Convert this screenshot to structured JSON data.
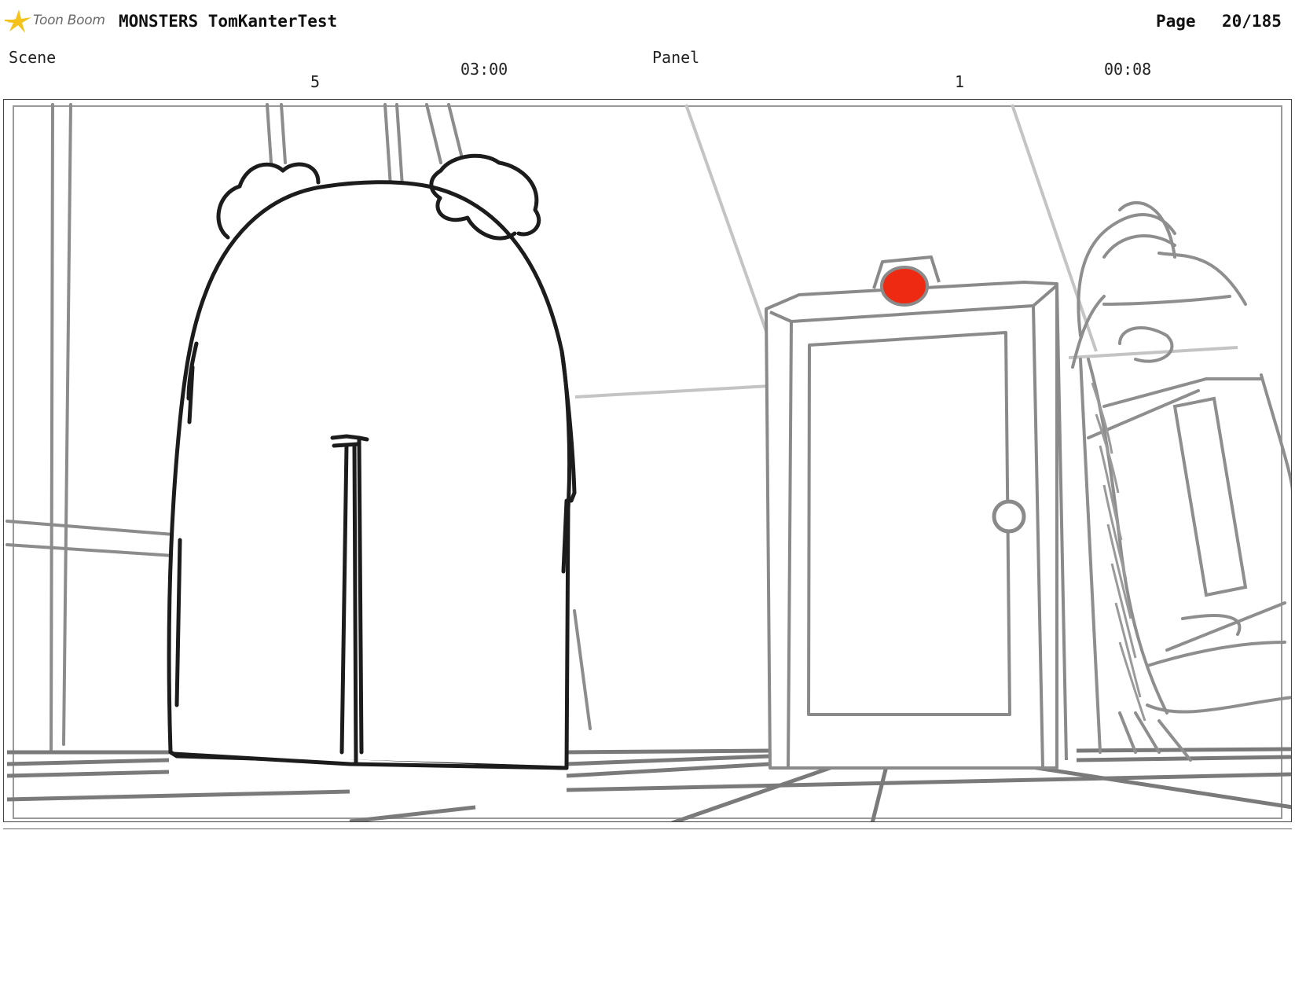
{
  "header": {
    "logo_text": "Toon Boom",
    "project_title": "MONSTERS TomKanterTest",
    "page_label": "Page",
    "page_value": "20/185"
  },
  "scene": {
    "label": "Scene",
    "number": "5",
    "duration": "03:00"
  },
  "panel": {
    "label": "Panel",
    "number": "1",
    "duration": "00:08"
  },
  "colors": {
    "door_light": "#ee2a12",
    "logo_star": "#f4c21b"
  }
}
